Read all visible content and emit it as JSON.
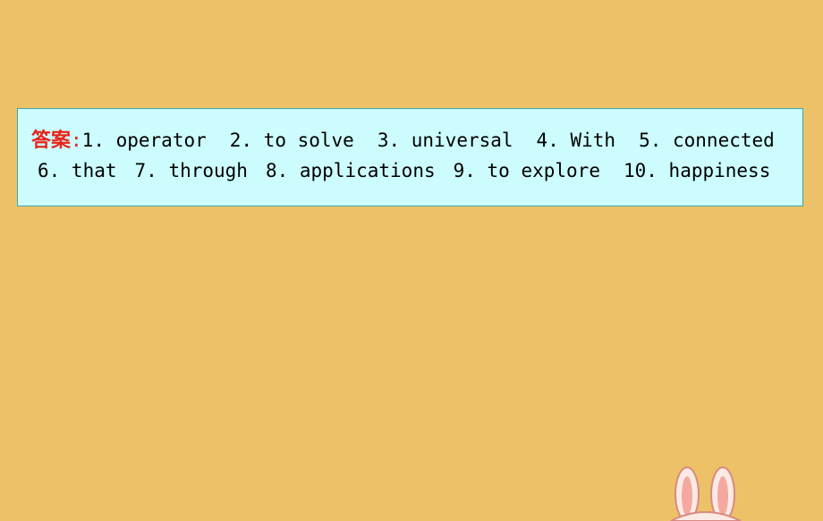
{
  "slide": {
    "background_color": "#edc167",
    "answer_box": {
      "background_color": "#ccfcfd",
      "border_color": "#3aa9b0",
      "label": "答案",
      "label_color": "#e8241a",
      "colon": ":",
      "line1": [
        "1. operator",
        "2. to solve",
        "3. universal",
        "4. With",
        "5. connected"
      ],
      "line2": [
        "6. that",
        "7. through",
        "8. applications",
        "9. to explore",
        "10. happiness"
      ]
    },
    "decoration": {
      "rabbit_icon": "rabbit-ears-graphic",
      "ear_color": "#f4a9a0",
      "outline_color": "#d98a80"
    }
  }
}
